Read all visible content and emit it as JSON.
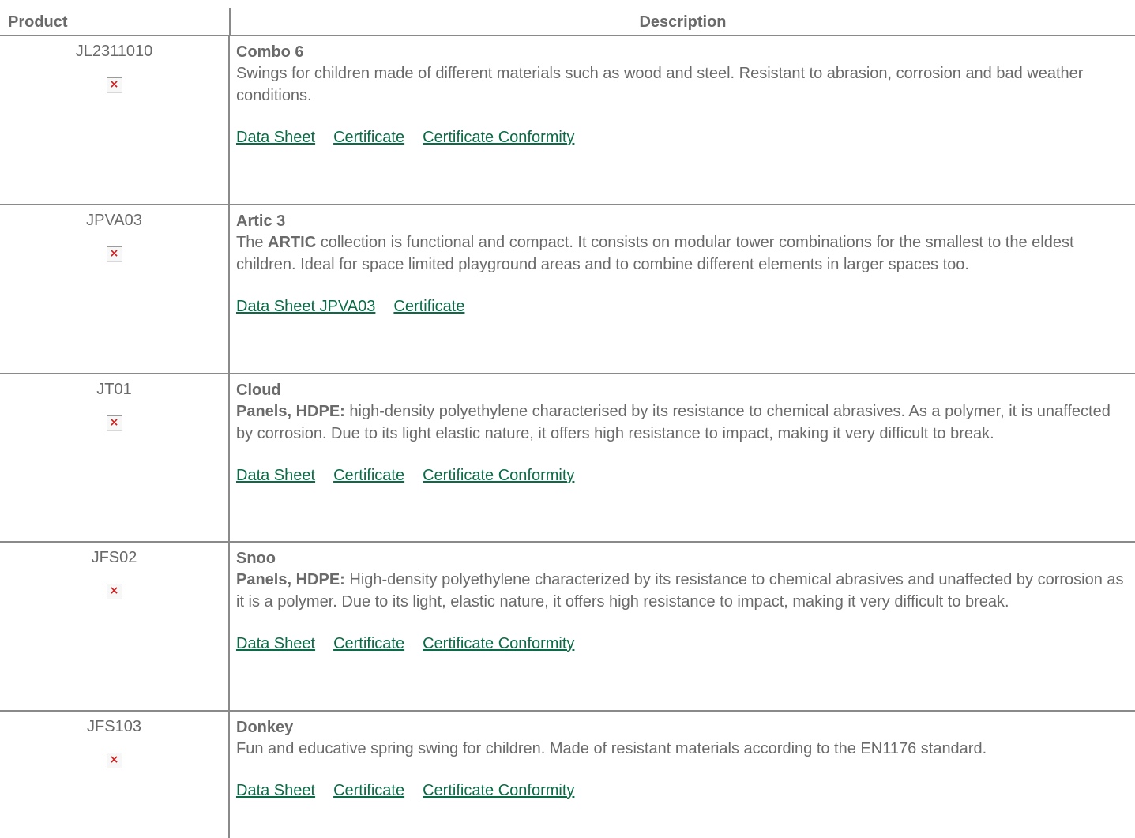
{
  "header": {
    "product_label": "Product",
    "description_label": "Description"
  },
  "rows": [
    {
      "code": "JL2311010",
      "image_icon": "broken-image-icon",
      "name": "Combo 6",
      "text_bold": "",
      "text": "Swings for children made of different materials such as wood and steel. Resistant to abrasion, corrosion and bad weather conditions.",
      "links": [
        "Data Sheet",
        "Certificate",
        "Certificate Conformity"
      ]
    },
    {
      "code": "JPVA03",
      "image_icon": "broken-image-icon",
      "name": "Artic 3",
      "text_prefix": "The ",
      "text_bold_inline": "ARTIC",
      "text": " collection is functional and compact. It consists on modular tower combinations for the smallest to the eldest children. Ideal for space limited playground areas and to combine different elements in larger spaces too.",
      "links": [
        "Data Sheet JPVA03",
        "Certificate"
      ]
    },
    {
      "code": "JT01",
      "image_icon": "broken-image-icon",
      "name": "Cloud",
      "text_bold": "Panels, HDPE:",
      "text": " high-density polyethylene characterised by its resistance to chemical abrasives. As a polymer, it is unaffected by corrosion. Due to its light elastic nature, it offers high resistance to impact, making it very difficult to break.",
      "links": [
        "Data Sheet",
        "Certificate",
        "Certificate Conformity"
      ]
    },
    {
      "code": "JFS02",
      "image_icon": "broken-image-icon",
      "name": "Snoo",
      "text_bold": "Panels, HDPE:",
      "text": " High-density polyethylene characterized by its resistance to chemical abrasives and unaffected by corrosion as it is a polymer. Due to its light, elastic nature, it offers high resistance to impact, making it very difficult to break.",
      "links": [
        "Data Sheet",
        "Certificate",
        "Certificate Conformity"
      ]
    },
    {
      "code": "JFS103",
      "image_icon": "broken-image-icon",
      "name": "Donkey",
      "text_bold": "",
      "text": "Fun and educative spring swing for children. Made of resistant materials according to the EN1176 standard.",
      "links": [
        "Data Sheet",
        "Certificate",
        "Certificate Conformity"
      ]
    }
  ],
  "colors": {
    "text": "#6a6a6a",
    "link": "#0a6b46",
    "divider": "#8a8a8a",
    "broken_icon": "#d11a1a"
  }
}
